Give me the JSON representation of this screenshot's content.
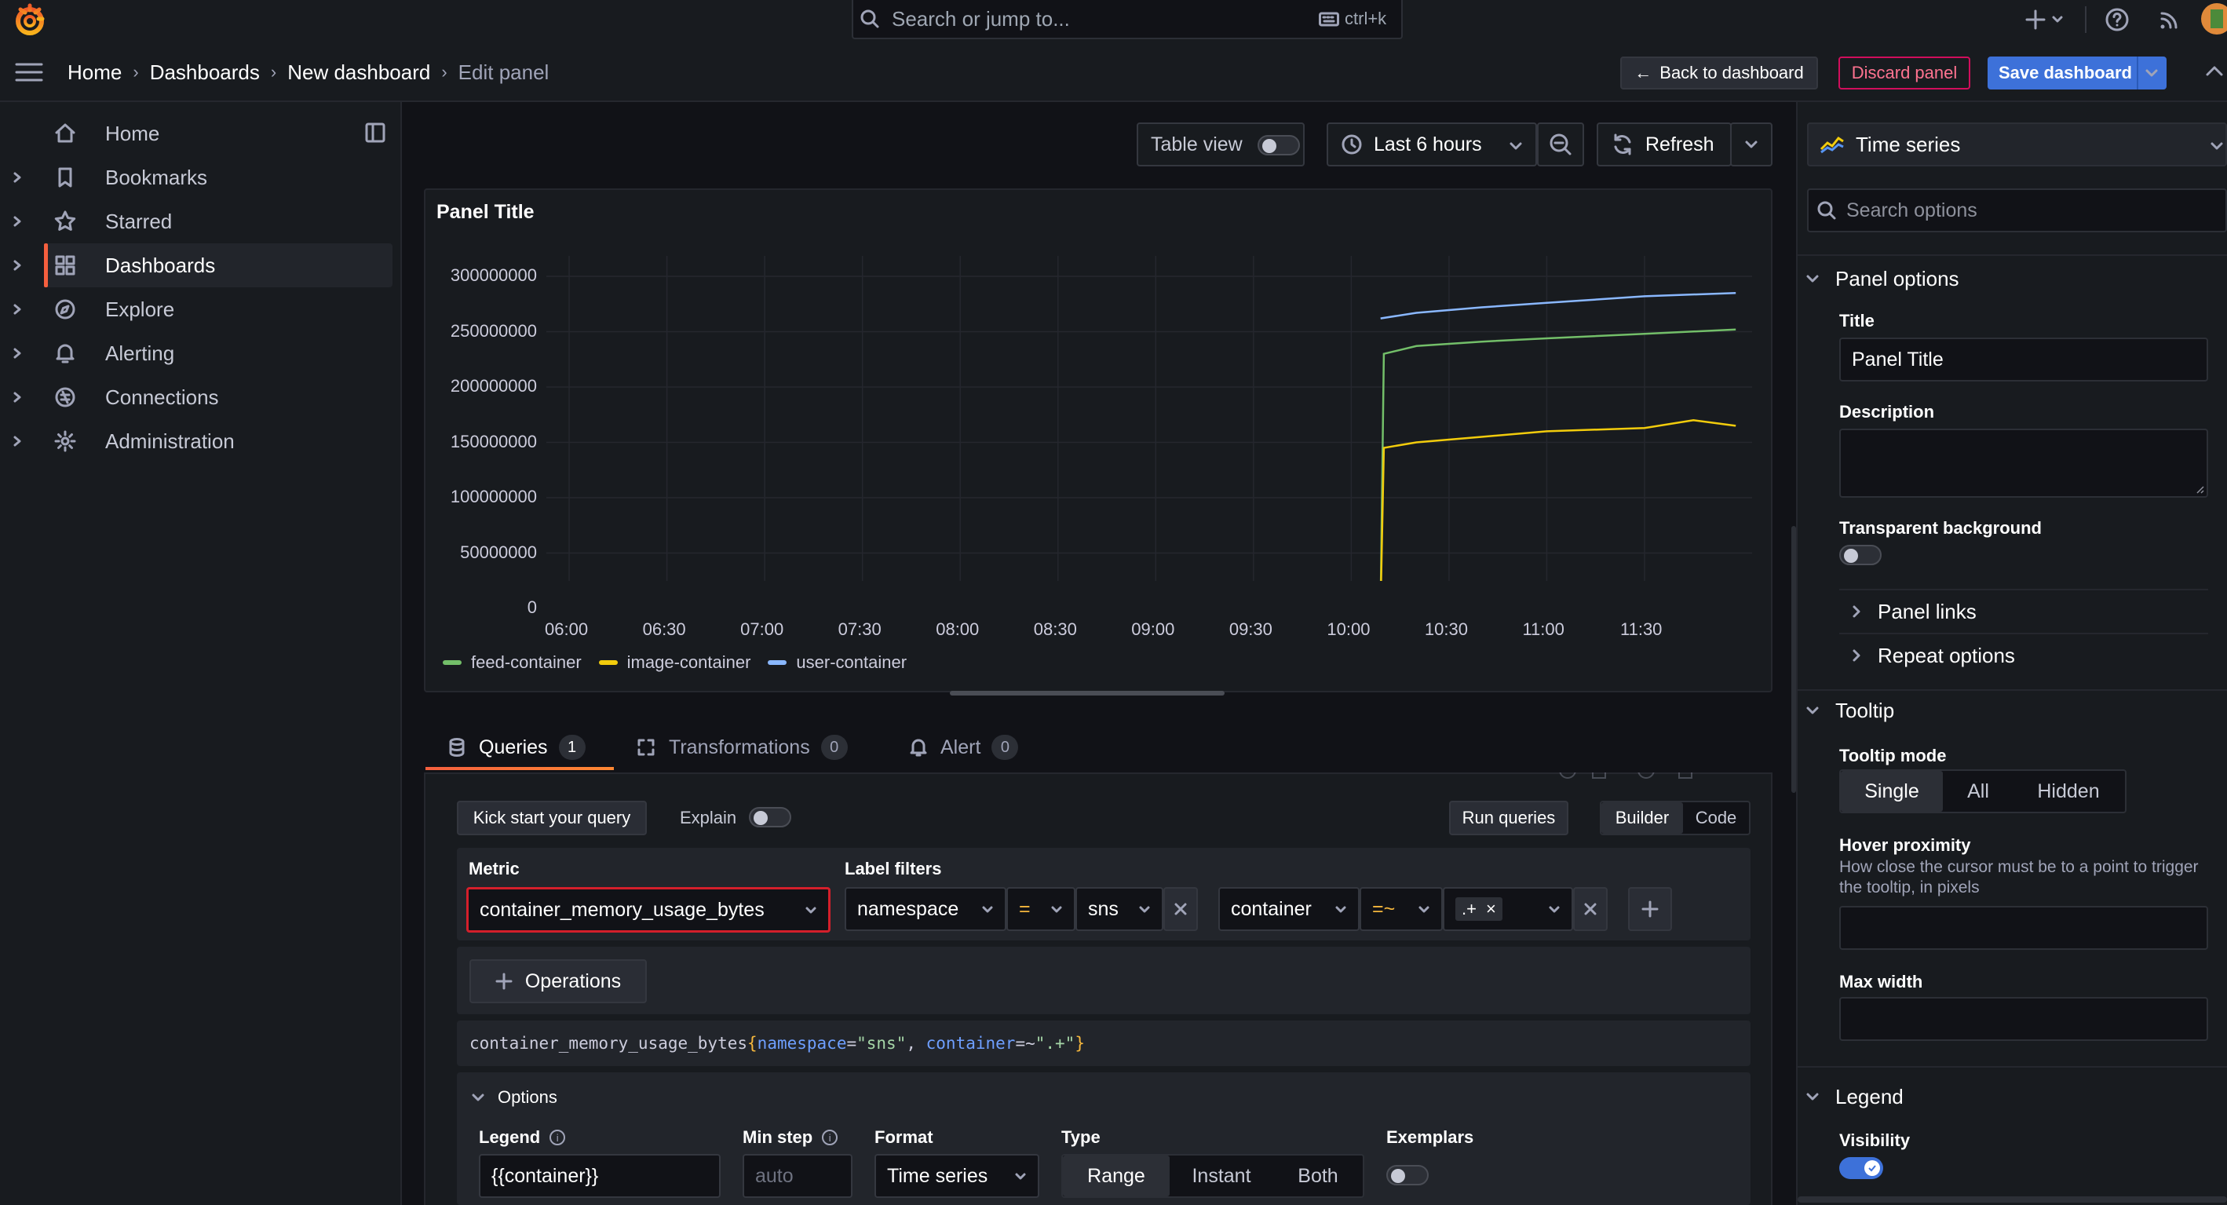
{
  "search": {
    "placeholder": "Search or jump to...",
    "shortcut": "ctrl+k"
  },
  "breadcrumb": [
    "Home",
    "Dashboards",
    "New dashboard",
    "Edit panel"
  ],
  "header_buttons": {
    "back": "Back to dashboard",
    "discard": "Discard panel",
    "save": "Save dashboard"
  },
  "sidebar": {
    "items": [
      {
        "label": "Home",
        "icon": "home-icon"
      },
      {
        "label": "Bookmarks",
        "icon": "bookmark-icon"
      },
      {
        "label": "Starred",
        "icon": "star-icon"
      },
      {
        "label": "Dashboards",
        "icon": "apps-icon",
        "active": true
      },
      {
        "label": "Explore",
        "icon": "compass-icon"
      },
      {
        "label": "Alerting",
        "icon": "bell-icon"
      },
      {
        "label": "Connections",
        "icon": "connections-icon"
      },
      {
        "label": "Administration",
        "icon": "cog-icon"
      }
    ]
  },
  "toolbar": {
    "table_view": "Table view",
    "time_range": "Last 6 hours",
    "refresh": "Refresh"
  },
  "panel": {
    "title": "Panel Title"
  },
  "chart_data": {
    "type": "line",
    "y_ticks": [
      "300000000",
      "250000000",
      "200000000",
      "150000000",
      "100000000",
      "50000000",
      "0"
    ],
    "x_ticks": [
      "06:00",
      "06:30",
      "07:00",
      "07:30",
      "08:00",
      "08:30",
      "09:00",
      "09:30",
      "10:00",
      "10:30",
      "11:00",
      "11:30"
    ],
    "ylim": [
      0,
      300000000
    ],
    "series": [
      {
        "name": "feed-container",
        "color": "#73bf69",
        "points": [
          [
            "10:09",
            0
          ],
          [
            "10:10",
            230000000
          ],
          [
            "10:20",
            237000000
          ],
          [
            "10:40",
            241000000
          ],
          [
            "11:00",
            244000000
          ],
          [
            "11:30",
            248000000
          ],
          [
            "11:58",
            252000000
          ]
        ]
      },
      {
        "name": "image-container",
        "color": "#f2cc0c",
        "points": [
          [
            "10:09",
            0
          ],
          [
            "10:10",
            145000000
          ],
          [
            "10:20",
            150000000
          ],
          [
            "10:40",
            155000000
          ],
          [
            "11:00",
            160000000
          ],
          [
            "11:30",
            163000000
          ],
          [
            "11:45",
            170000000
          ],
          [
            "11:58",
            165000000
          ]
        ]
      },
      {
        "name": "user-container",
        "color": "#8ab8ff",
        "points": [
          [
            "10:09",
            262000000
          ],
          [
            "10:20",
            267000000
          ],
          [
            "10:40",
            272000000
          ],
          [
            "11:00",
            276000000
          ],
          [
            "11:30",
            282000000
          ],
          [
            "11:58",
            285000000
          ]
        ]
      }
    ]
  },
  "query_tabs": [
    {
      "label": "Queries",
      "count": "1"
    },
    {
      "label": "Transformations",
      "count": "0"
    },
    {
      "label": "Alert",
      "count": "0"
    }
  ],
  "query": {
    "kick_start": "Kick start your query",
    "explain": "Explain",
    "run": "Run queries",
    "builder": "Builder",
    "code": "Code",
    "metric_label": "Metric",
    "metric": "container_memory_usage_bytes",
    "label_filters_label": "Label filters",
    "filter1": {
      "key": "namespace",
      "op": "=",
      "value": "sns"
    },
    "filter2": {
      "key": "container",
      "op": "=~",
      "value": ".+"
    },
    "operations": "Operations",
    "promql": {
      "metric": "container_memory_usage_bytes",
      "k1": "namespace",
      "op1": "=",
      "v1": "\"sns\"",
      "sep": ", ",
      "k2": "container",
      "op2": "=~",
      "v2": "\".+\""
    },
    "options_title": "Options",
    "legend_label": "Legend",
    "legend_value": "{{container}}",
    "min_step_label": "Min step",
    "min_step_placeholder": "auto",
    "format_label": "Format",
    "format_value": "Time series",
    "type_label": "Type",
    "type_options": [
      "Range",
      "Instant",
      "Both"
    ],
    "exemplars_label": "Exemplars"
  },
  "options_pane": {
    "viz": "Time series",
    "search_placeholder": "Search options",
    "panel_options": "Panel options",
    "title_label": "Title",
    "title_value": "Panel Title",
    "description_label": "Description",
    "transparent_label": "Transparent background",
    "panel_links": "Panel links",
    "repeat_options": "Repeat options",
    "tooltip": "Tooltip",
    "tooltip_mode_label": "Tooltip mode",
    "tooltip_modes": [
      "Single",
      "All",
      "Hidden"
    ],
    "hover_label": "Hover proximity",
    "hover_desc": "How close the cursor must be to a point to trigger the tooltip, in pixels",
    "max_width_label": "Max width",
    "legend": "Legend",
    "visibility_label": "Visibility"
  }
}
